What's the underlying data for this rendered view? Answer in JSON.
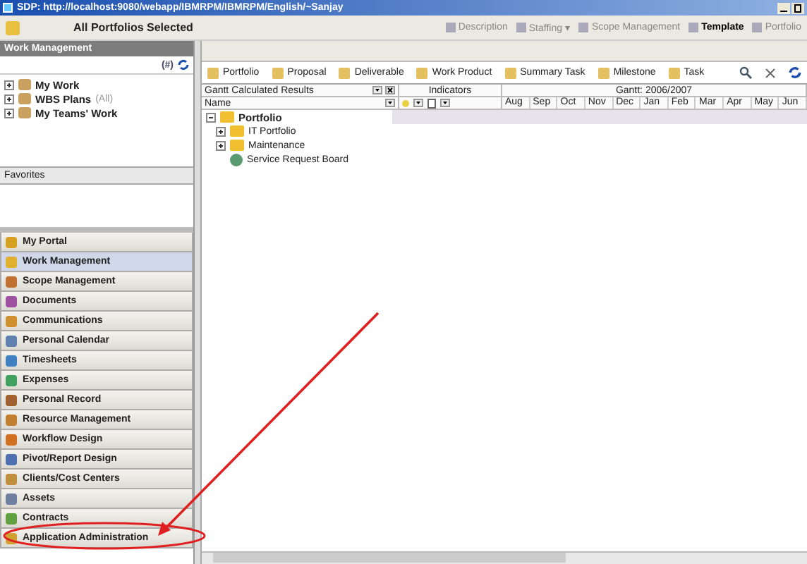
{
  "window": {
    "title": "SDP: http://localhost:9080/webapp/IBMRPM/IBMRPM/English/~Sanjay"
  },
  "header": {
    "title": "All Portfolios Selected",
    "actions": [
      {
        "label": "Description",
        "disabled": true
      },
      {
        "label": "Staffing ▾",
        "disabled": true
      },
      {
        "label": "Scope Management",
        "disabled": true
      },
      {
        "label": "Template",
        "disabled": false
      },
      {
        "label": "Portfolio",
        "disabled": true
      }
    ]
  },
  "left_panel": {
    "title": "Work Management",
    "filter_label": "(#)",
    "tree": [
      {
        "label": "My Work"
      },
      {
        "label": "WBS Plans",
        "note": "(All)"
      },
      {
        "label": "My Teams' Work"
      }
    ],
    "favorites_title": "Favorites"
  },
  "nav": [
    {
      "label": "My Portal",
      "selected": false,
      "color": "#d8a020"
    },
    {
      "label": "Work Management",
      "selected": true,
      "color": "#e0b030"
    },
    {
      "label": "Scope Management",
      "selected": false,
      "color": "#c07030"
    },
    {
      "label": "Documents",
      "selected": false,
      "color": "#a050a0"
    },
    {
      "label": "Communications",
      "selected": false,
      "color": "#d09030"
    },
    {
      "label": "Personal Calendar",
      "selected": false,
      "color": "#6080b0"
    },
    {
      "label": "Timesheets",
      "selected": false,
      "color": "#4080c0"
    },
    {
      "label": "Expenses",
      "selected": false,
      "color": "#40a060"
    },
    {
      "label": "Personal Record",
      "selected": false,
      "color": "#a06030"
    },
    {
      "label": "Resource Management",
      "selected": false,
      "color": "#c08030"
    },
    {
      "label": "Workflow Design",
      "selected": false,
      "color": "#d07020"
    },
    {
      "label": "Pivot/Report Design",
      "selected": false,
      "color": "#5070b0"
    },
    {
      "label": "Clients/Cost Centers",
      "selected": false,
      "color": "#c09040"
    },
    {
      "label": "Assets",
      "selected": false,
      "color": "#7080a0"
    },
    {
      "label": "Contracts",
      "selected": false,
      "color": "#60a040"
    },
    {
      "label": "Application Administration",
      "selected": false,
      "color": "#d0a030"
    }
  ],
  "toolbar": [
    "Portfolio",
    "Proposal",
    "Deliverable",
    "Work Product",
    "Summary Task",
    "Milestone",
    "Task"
  ],
  "grid": {
    "results_label": "Gantt Calculated Results",
    "indicators_label": "Indicators",
    "gantt_label": "Gantt: 2006/2007",
    "name_column": "Name",
    "months": [
      "Aug",
      "Sep",
      "Oct",
      "Nov",
      "Dec",
      "Jan",
      "Feb",
      "Mar",
      "Apr",
      "May",
      "Jun"
    ],
    "rows": [
      {
        "label": "Portfolio",
        "kind": "folder",
        "expanded": true,
        "children": [
          {
            "label": "IT Portfolio",
            "kind": "folder",
            "expanded": false
          },
          {
            "label": "Maintenance",
            "kind": "folder",
            "expanded": false
          },
          {
            "label": "Service Request Board",
            "kind": "board"
          }
        ]
      }
    ]
  }
}
